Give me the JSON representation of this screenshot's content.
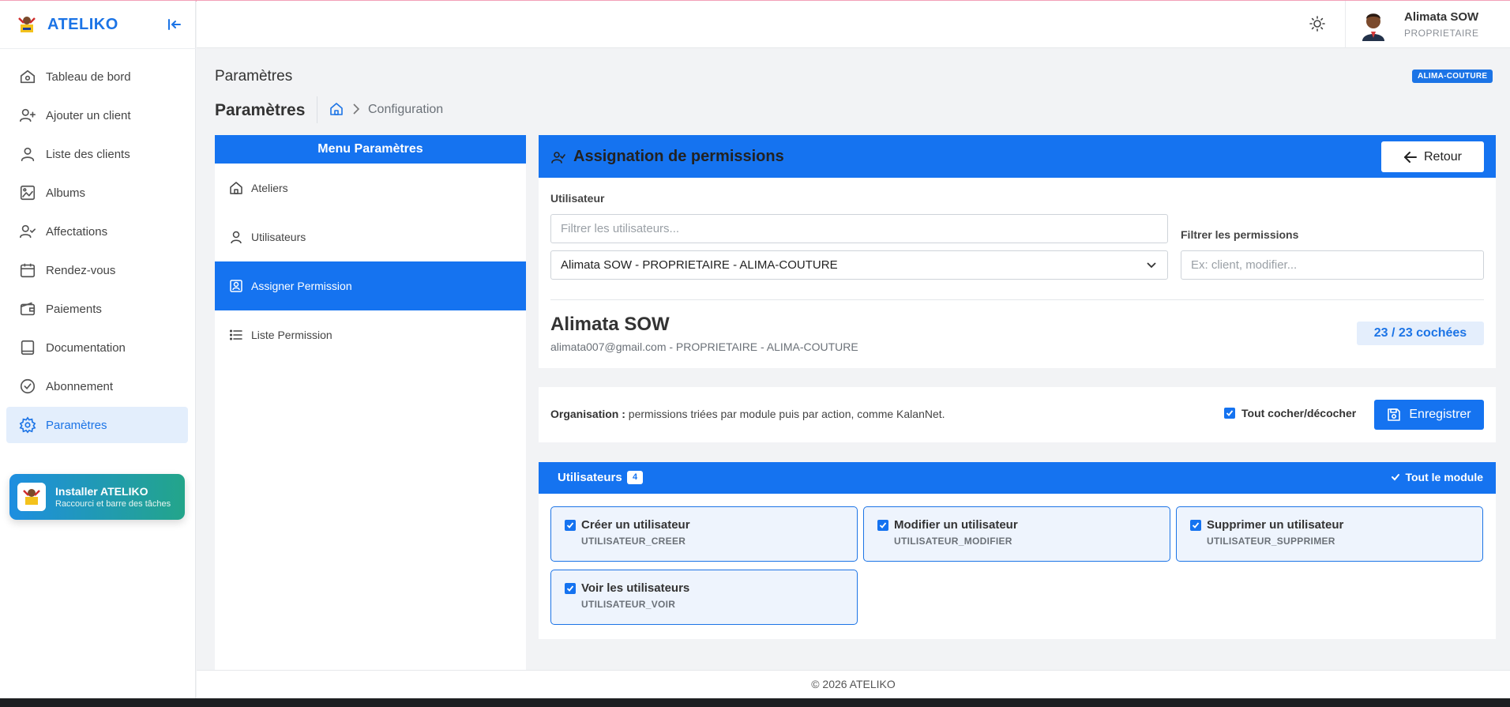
{
  "app": {
    "name": "ATELIKO",
    "brand_color": "#1c74e6"
  },
  "sidebar": {
    "items": [
      {
        "label": "Tableau de bord",
        "icon": "home-icon"
      },
      {
        "label": "Ajouter un client",
        "icon": "user-plus-icon"
      },
      {
        "label": "Liste des clients",
        "icon": "user-icon"
      },
      {
        "label": "Albums",
        "icon": "image-icon"
      },
      {
        "label": "Affectations",
        "icon": "user-check-icon"
      },
      {
        "label": "Rendez-vous",
        "icon": "calendar-icon"
      },
      {
        "label": "Paiements",
        "icon": "wallet-icon"
      },
      {
        "label": "Documentation",
        "icon": "book-icon"
      },
      {
        "label": "Abonnement",
        "icon": "badge-check-icon"
      },
      {
        "label": "Paramètres",
        "icon": "gear-icon",
        "active": true
      }
    ],
    "install": {
      "title": "Installer ATELIKO",
      "subtitle": "Raccourci et barre des tâches"
    }
  },
  "header": {
    "user_name": "Alimata SOW",
    "user_role": "PROPRIETAIRE"
  },
  "page": {
    "title": "Paramètres",
    "org_tag": "ALIMA-COUTURE",
    "subtitle": "Paramètres",
    "breadcrumb": "Configuration"
  },
  "settings_menu": {
    "title": "Menu Paramètres",
    "items": [
      {
        "label": "Ateliers",
        "icon": "home-icon"
      },
      {
        "label": "Utilisateurs",
        "icon": "user-icon"
      },
      {
        "label": "Assigner Permission",
        "icon": "user-badge-icon",
        "active": true
      },
      {
        "label": "Liste Permission",
        "icon": "list-icon"
      }
    ]
  },
  "assign": {
    "title": "Assignation de permissions",
    "back_label": "Retour",
    "user_label": "Utilisateur",
    "user_filter_placeholder": "Filtrer les utilisateurs...",
    "selected_user": "Alimata SOW - PROPRIETAIRE - ALIMA-COUTURE",
    "perm_filter_label": "Filtrer les permissions",
    "perm_filter_placeholder": "Ex: client, modifier...",
    "user_name": "Alimata SOW",
    "user_info": "alimata007@gmail.com - PROPRIETAIRE - ALIMA-COUTURE",
    "checked_count": "23 / 23 cochées"
  },
  "organisation": {
    "label": "Organisation :",
    "text": "permissions triées par module puis par action, comme KalanNet.",
    "toggle_all": "Tout cocher/décocher",
    "save_label": "Enregistrer"
  },
  "module": {
    "title": "Utilisateurs",
    "count": "4",
    "toggle_module": "Tout le module",
    "permissions": [
      {
        "name": "Créer un utilisateur",
        "code": "UTILISATEUR_CREER",
        "checked": true
      },
      {
        "name": "Modifier un utilisateur",
        "code": "UTILISATEUR_MODIFIER",
        "checked": true
      },
      {
        "name": "Supprimer un utilisateur",
        "code": "UTILISATEUR_SUPPRIMER",
        "checked": true
      },
      {
        "name": "Voir les utilisateurs",
        "code": "UTILISATEUR_VOIR",
        "checked": true
      }
    ]
  },
  "footer": {
    "text": "© 2026 ATELIKO"
  }
}
